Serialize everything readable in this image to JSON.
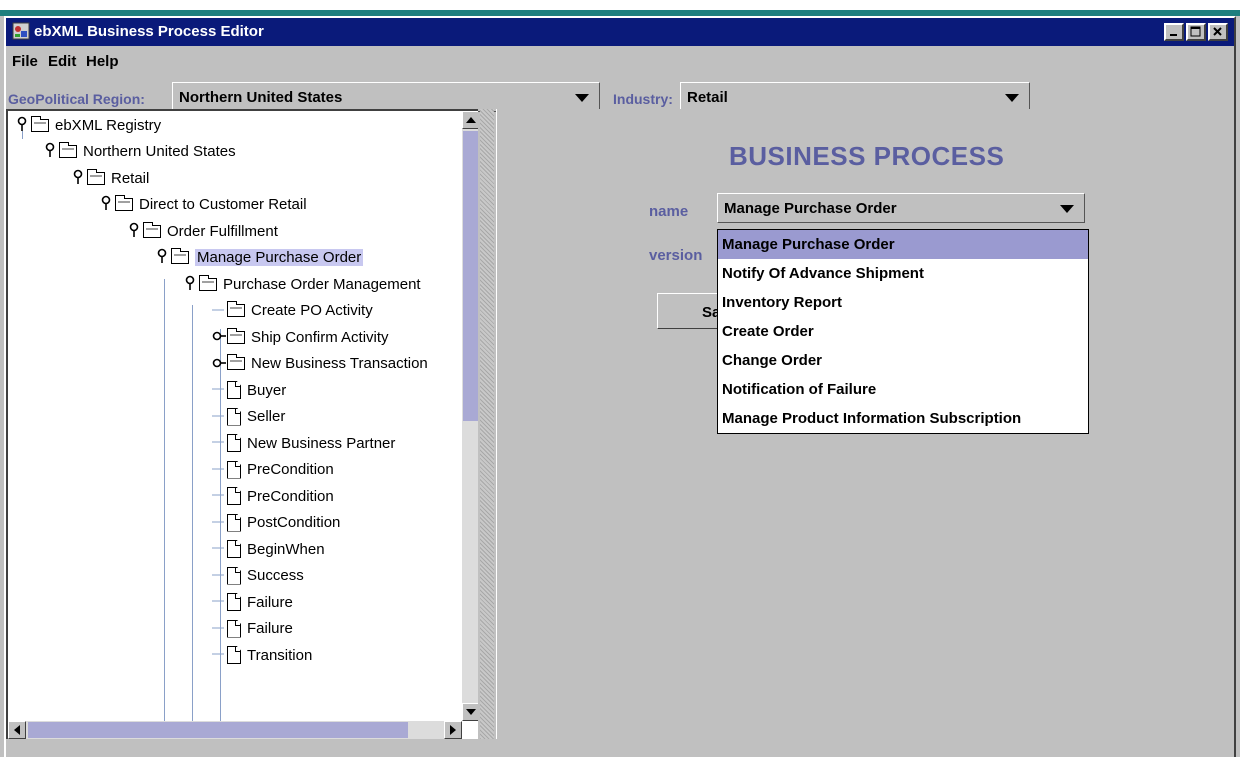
{
  "window": {
    "title": "ebXML Business Process Editor"
  },
  "menu": {
    "file": "File",
    "edit": "Edit",
    "help": "Help"
  },
  "filters": {
    "geo_label": "GeoPolitical Region:",
    "geo_value": "Northern United States",
    "industry_label": "Industry:",
    "industry_value": "Retail"
  },
  "tree": {
    "nodes": [
      {
        "label": "ebXML Registry",
        "type": "folder",
        "toggle": "expanded",
        "level": 0
      },
      {
        "label": "Northern United States",
        "type": "folder",
        "toggle": "expanded",
        "level": 1
      },
      {
        "label": "Retail",
        "type": "folder",
        "toggle": "expanded",
        "level": 2
      },
      {
        "label": "Direct to Customer Retail",
        "type": "folder",
        "toggle": "expanded",
        "level": 3
      },
      {
        "label": "Order Fulfillment",
        "type": "folder",
        "toggle": "expanded",
        "level": 4
      },
      {
        "label": "Manage Purchase Order",
        "type": "folder",
        "toggle": "expanded",
        "level": 5,
        "selected": true
      },
      {
        "label": "Purchase Order Management",
        "type": "folder",
        "toggle": "expanded",
        "level": 6
      },
      {
        "label": "Create PO Activity",
        "type": "folder",
        "toggle": "none",
        "level": 7
      },
      {
        "label": "Ship Confirm Activity",
        "type": "folder",
        "toggle": "collapsed",
        "level": 7
      },
      {
        "label": "New Business Transaction",
        "type": "folder",
        "toggle": "collapsed",
        "level": 7
      },
      {
        "label": "Buyer",
        "type": "doc",
        "toggle": "none",
        "level": 7
      },
      {
        "label": "Seller",
        "type": "doc",
        "toggle": "none",
        "level": 7
      },
      {
        "label": "New Business Partner",
        "type": "doc",
        "toggle": "none",
        "level": 7
      },
      {
        "label": "PreCondition",
        "type": "doc",
        "toggle": "none",
        "level": 7
      },
      {
        "label": "PreCondition",
        "type": "doc",
        "toggle": "none",
        "level": 7
      },
      {
        "label": "PostCondition",
        "type": "doc",
        "toggle": "none",
        "level": 7
      },
      {
        "label": "BeginWhen",
        "type": "doc",
        "toggle": "none",
        "level": 7
      },
      {
        "label": "Success",
        "type": "doc",
        "toggle": "none",
        "level": 7
      },
      {
        "label": "Failure",
        "type": "doc",
        "toggle": "none",
        "level": 7
      },
      {
        "label": "Failure",
        "type": "doc",
        "toggle": "none",
        "level": 7
      },
      {
        "label": "Transition",
        "type": "doc",
        "toggle": "none",
        "level": 7
      }
    ]
  },
  "form": {
    "title": "BUSINESS PROCESS",
    "name_label": "name",
    "name_value": "Manage Purchase Order",
    "version_label": "version",
    "save_label_partial": "Sa",
    "dropdown_options": [
      "Manage Purchase Order",
      "Notify Of Advance Shipment",
      "Inventory Report",
      "Create Order",
      "Change Order",
      "Notification of Failure",
      "Manage Product Information Subscription"
    ],
    "dropdown_selected": "Manage Purchase Order"
  },
  "icons": {
    "expanded": "key-expanded-icon",
    "collapsed": "key-collapsed-icon",
    "folder": "folder-icon",
    "doc": "document-icon"
  },
  "colors": {
    "title_bar": "#0a1a7a",
    "label_blue": "#5a5ea0",
    "selection": "#9a9ad0"
  }
}
